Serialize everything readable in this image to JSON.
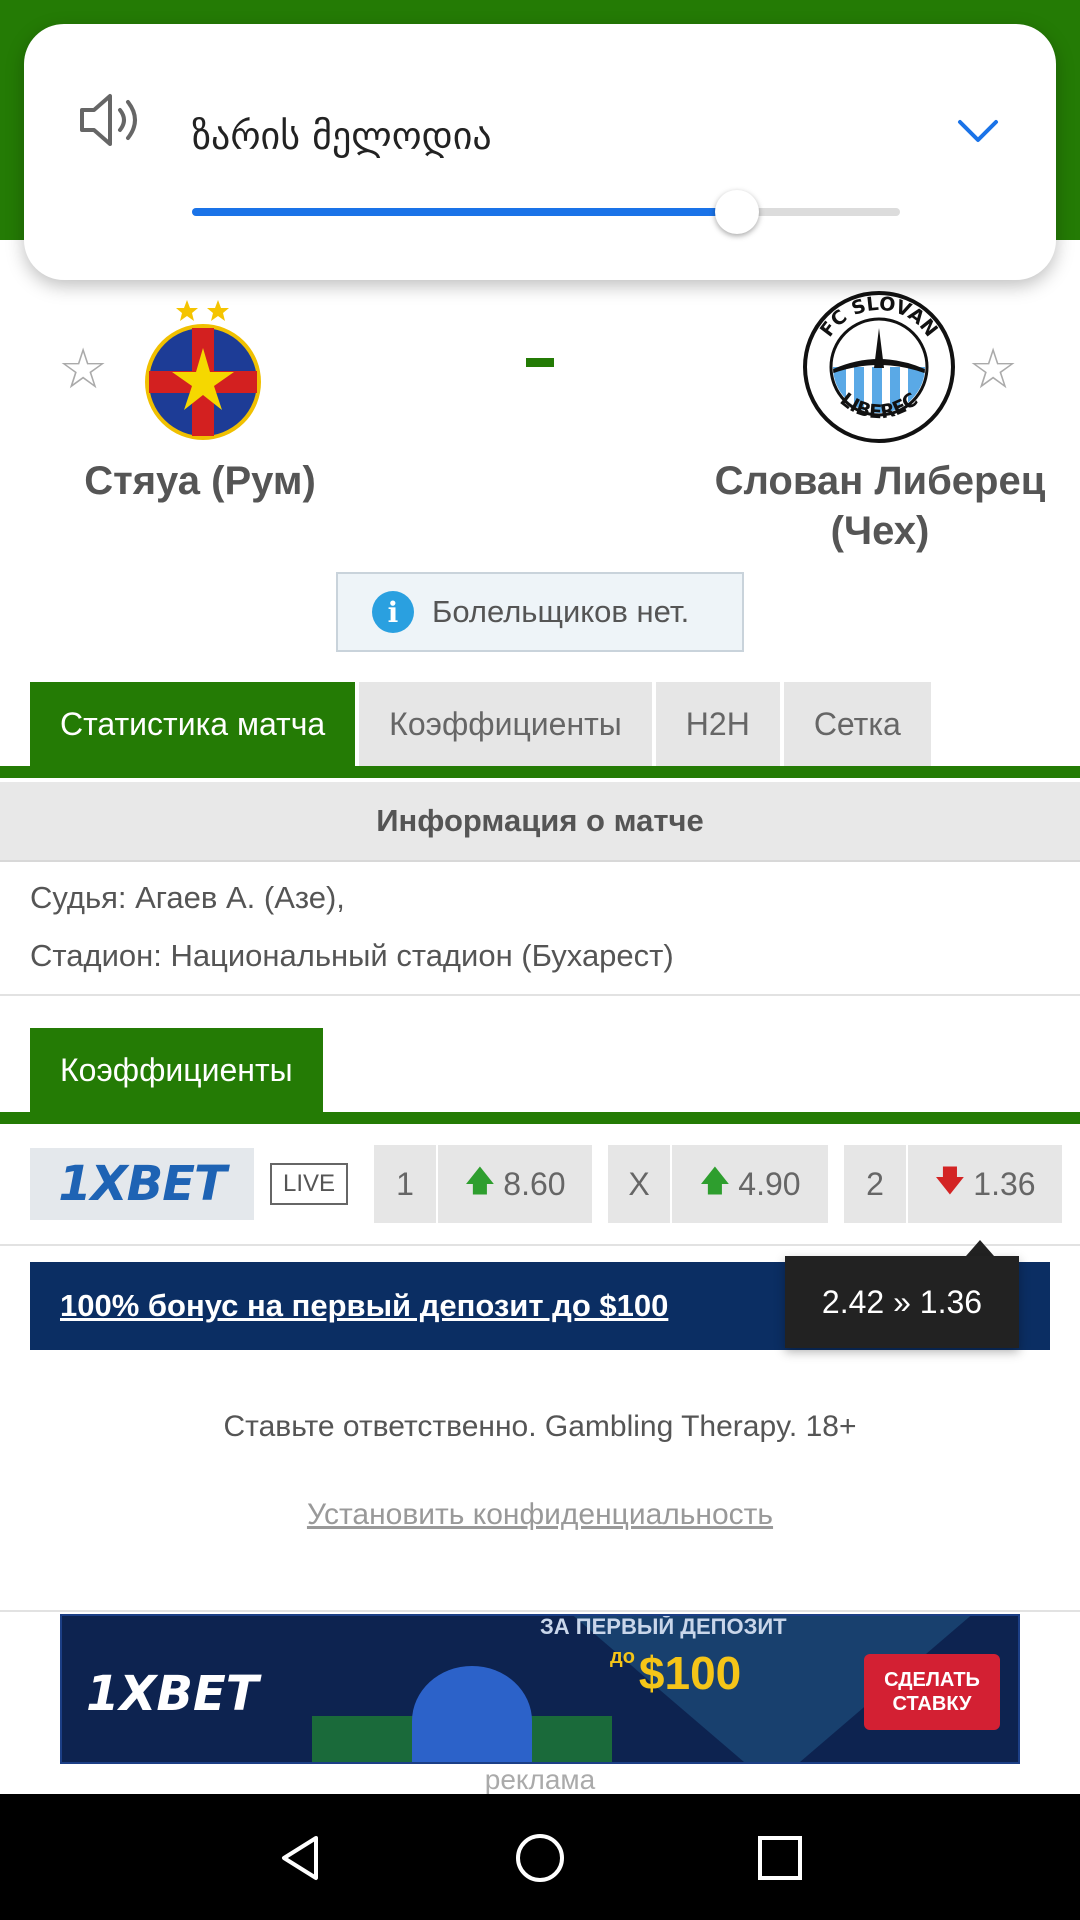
{
  "volume_popup": {
    "label": "ზარის მელოდია",
    "level_percent": 77
  },
  "match": {
    "home": {
      "name": "Стяуа (Рум)"
    },
    "away": {
      "name": "Слован Либерец (Чех)"
    },
    "score": "-",
    "fans_note": "Болельщиков нет."
  },
  "tabs": [
    {
      "label": "Статистика матча",
      "active": true
    },
    {
      "label": "Коэффициенты",
      "active": false
    },
    {
      "label": "H2H",
      "active": false
    },
    {
      "label": "Сетка",
      "active": false
    }
  ],
  "match_info": {
    "heading": "Информация о матче",
    "referee": "Судья: Агаев А. (Азе),",
    "stadium": "Стадион: Национальный стадион (Бухарест)"
  },
  "odds": {
    "tab_label": "Коэффициенты",
    "bookmaker": "1XBET",
    "live_badge": "LIVE",
    "items": [
      {
        "label": "1",
        "value": "8.60",
        "trend": "up"
      },
      {
        "label": "X",
        "value": "4.90",
        "trend": "up"
      },
      {
        "label": "2",
        "value": "1.36",
        "trend": "down"
      }
    ],
    "tooltip": "2.42 » 1.36",
    "bonus_link": "100% бонус на первый депозит до $100"
  },
  "footer": {
    "responsible": "Ставьте ответственно. Gambling Therapy. 18+",
    "privacy_link": "Установить конфиденциальность"
  },
  "ad": {
    "logo": "1XBET",
    "top_text": "ЗА ПЕРВЫЙ ДЕПОЗИТ",
    "amount_prefix": "до",
    "amount": "$100",
    "cta": "СДЕЛАТЬ СТАВКУ",
    "label": "реклама"
  },
  "colors": {
    "brand_green": "#247b05",
    "accent_blue": "#1a73e8",
    "up": "#2e9e2e",
    "down": "#d32424",
    "bonus_bg": "#0b2e63"
  },
  "icons": [
    "speaker-icon",
    "chevron-down-icon",
    "star-icon",
    "info-icon",
    "arrow-up-icon",
    "arrow-down-icon",
    "back-icon",
    "home-icon",
    "recents-icon"
  ]
}
